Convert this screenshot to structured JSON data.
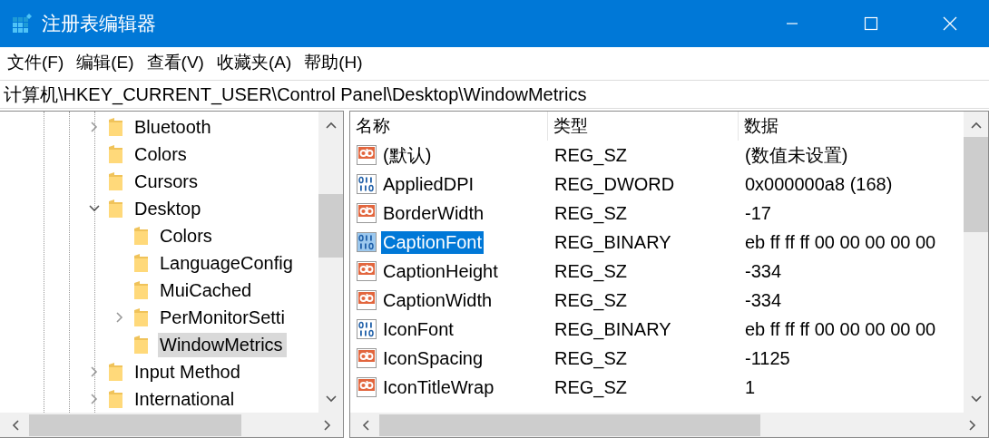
{
  "window": {
    "title": "注册表编辑器"
  },
  "menu": [
    "文件(F)",
    "编辑(E)",
    "查看(V)",
    "收藏夹(A)",
    "帮助(H)"
  ],
  "address": "计算机\\HKEY_CURRENT_USER\\Control Panel\\Desktop\\WindowMetrics",
  "tree": [
    {
      "kind": "collapsed",
      "label": "Bluetooth",
      "selected": false
    },
    {
      "kind": "leaf",
      "label": "Colors",
      "selected": false
    },
    {
      "kind": "leaf",
      "label": "Cursors",
      "selected": false
    },
    {
      "kind": "expanded",
      "label": "Desktop",
      "selected": false,
      "children": [
        {
          "kind": "leaf",
          "label": "Colors",
          "selected": false
        },
        {
          "kind": "leaf",
          "label": "LanguageConfig",
          "selected": false
        },
        {
          "kind": "leaf",
          "label": "MuiCached",
          "selected": false
        },
        {
          "kind": "collapsed",
          "label": "PerMonitorSetti",
          "selected": false
        },
        {
          "kind": "leaf",
          "label": "WindowMetrics",
          "selected": true
        }
      ]
    },
    {
      "kind": "collapsed",
      "label": "Input Method",
      "selected": false
    },
    {
      "kind": "collapsed",
      "label": "International",
      "selected": false
    }
  ],
  "table": {
    "columns": [
      "名称",
      "类型",
      "数据"
    ],
    "rows": [
      {
        "kind": "string",
        "name": "(默认)",
        "type": "REG_SZ",
        "data": "(数值未设置)",
        "selected": false
      },
      {
        "kind": "binary",
        "name": "AppliedDPI",
        "type": "REG_DWORD",
        "data": "0x000000a8 (168)",
        "selected": false
      },
      {
        "kind": "string",
        "name": "BorderWidth",
        "type": "REG_SZ",
        "data": "-17",
        "selected": false
      },
      {
        "kind": "binary",
        "name": "CaptionFont",
        "type": "REG_BINARY",
        "data": "eb ff ff ff 00 00 00 00 00",
        "selected": true
      },
      {
        "kind": "string",
        "name": "CaptionHeight",
        "type": "REG_SZ",
        "data": "-334",
        "selected": false
      },
      {
        "kind": "string",
        "name": "CaptionWidth",
        "type": "REG_SZ",
        "data": "-334",
        "selected": false
      },
      {
        "kind": "binary",
        "name": "IconFont",
        "type": "REG_BINARY",
        "data": "eb ff ff ff 00 00 00 00 00",
        "selected": false
      },
      {
        "kind": "string",
        "name": "IconSpacing",
        "type": "REG_SZ",
        "data": "-1125",
        "selected": false
      },
      {
        "kind": "string",
        "name": "IconTitleWrap",
        "type": "REG_SZ",
        "data": "1",
        "selected": false
      }
    ]
  }
}
